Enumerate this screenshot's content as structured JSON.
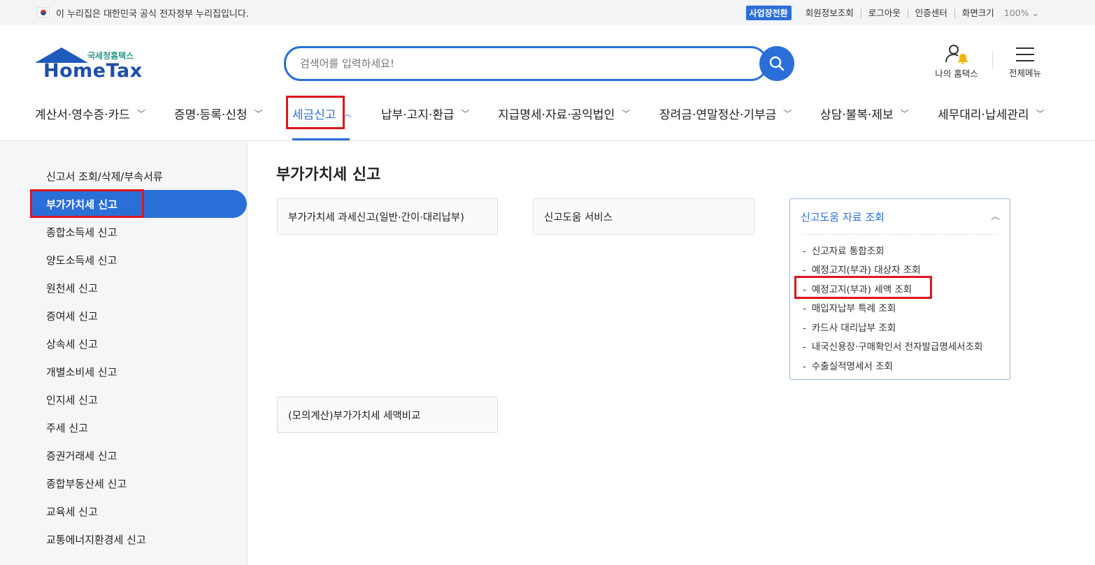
{
  "gov_banner": {
    "text": "이 누리집은 대한민국 공식 전자정부 누리집입니다."
  },
  "util_links": {
    "business_switch": "사업장전환",
    "member_info": "회원정보조회",
    "logout": "로그아웃",
    "cert_center": "인증센터",
    "screen_size": "화면크기",
    "zoom": "100%"
  },
  "logo": {
    "sub": "국세청홈택스",
    "main": "HomeTax"
  },
  "search": {
    "placeholder": "검색어를 입력하세요!"
  },
  "header_links": {
    "my_hometax": "나의 홈택스",
    "all_menu": "전체메뉴"
  },
  "gnb": {
    "items": [
      {
        "label": "계산서·영수증·카드"
      },
      {
        "label": "증명·등록·신청"
      },
      {
        "label": "세금신고"
      },
      {
        "label": "납부·고지·환급"
      },
      {
        "label": "지급명세·자료·공익법인"
      },
      {
        "label": "장려금·연말정산·기부금"
      },
      {
        "label": "상담·불복·제보"
      },
      {
        "label": "세무대리·납세관리"
      }
    ]
  },
  "sidebar": {
    "items": [
      {
        "label": "신고서 조회/삭제/부속서류"
      },
      {
        "label": "부가가치세 신고"
      },
      {
        "label": "종합소득세 신고"
      },
      {
        "label": "양도소득세 신고"
      },
      {
        "label": "원천세 신고"
      },
      {
        "label": "증여세 신고"
      },
      {
        "label": "상속세 신고"
      },
      {
        "label": "개별소비세 신고"
      },
      {
        "label": "인지세 신고"
      },
      {
        "label": "주세 신고"
      },
      {
        "label": "증권거래세 신고"
      },
      {
        "label": "종합부동산세 신고"
      },
      {
        "label": "교육세 신고"
      },
      {
        "label": "교통에너지환경세 신고"
      }
    ]
  },
  "content": {
    "title": "부가가치세 신고",
    "cards": [
      {
        "label": "부가가치세 과세신고(일반·간이·대리납부)"
      },
      {
        "label": "신고도움 서비스"
      },
      {
        "label": "(모의계산)부가가치세 세액비교"
      }
    ],
    "open_card": {
      "title": "신고도움 자료 조회",
      "items": [
        "신고자료 통합조회",
        "예정고지(부과) 대상자 조회",
        "예정고지(부과) 세액 조회",
        "매입자납부 특례 조회",
        "카드사 대리납부 조회",
        "내국신용장·구매확인서 전자발급명세서조회",
        "수출실적명세서 조회"
      ]
    }
  },
  "colors": {
    "accent": "#2a6fd8",
    "highlight_box": "#e0141e"
  }
}
